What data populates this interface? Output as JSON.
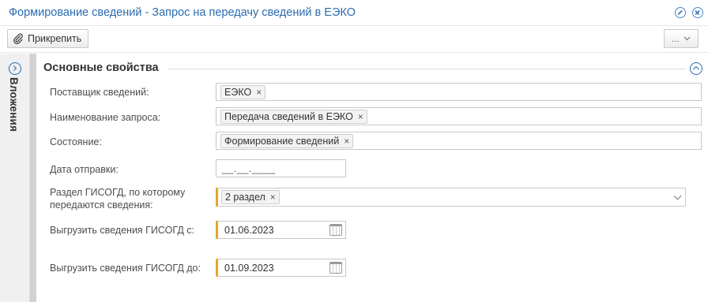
{
  "window": {
    "title": "Формирование сведений - Запрос на передачу сведений в ЕЭКО"
  },
  "toolbar": {
    "pin_label": "Прикрепить",
    "more_label": "..."
  },
  "sidebar": {
    "label": "Вложения"
  },
  "section": {
    "title": "Основные свойства"
  },
  "form": {
    "supplier": {
      "label": "Поставщик сведений:",
      "tag": "ЕЭКО"
    },
    "request_name": {
      "label": "Наименование запроса:",
      "tag": "Передача сведений в ЕЭКО"
    },
    "state": {
      "label": "Состояние:",
      "tag": "Формирование сведений"
    },
    "send_date": {
      "label": "Дата отправки:",
      "mask": "__.__.____"
    },
    "gisogd_section": {
      "label_line1": "Раздел ГИСОГД, по которому",
      "label_line2": "передаются сведения:",
      "tag": "2 раздел"
    },
    "export_from": {
      "label": "Выгрузить сведения ГИСОГД с:",
      "value": "01.06.2023"
    },
    "export_to": {
      "label": "Выгрузить сведения ГИСОГД до:",
      "value": "01.09.2023"
    }
  },
  "colors": {
    "accent": "#2b6cae",
    "required_marker": "#e5a52a"
  },
  "icons": {
    "tag_remove": "×"
  }
}
